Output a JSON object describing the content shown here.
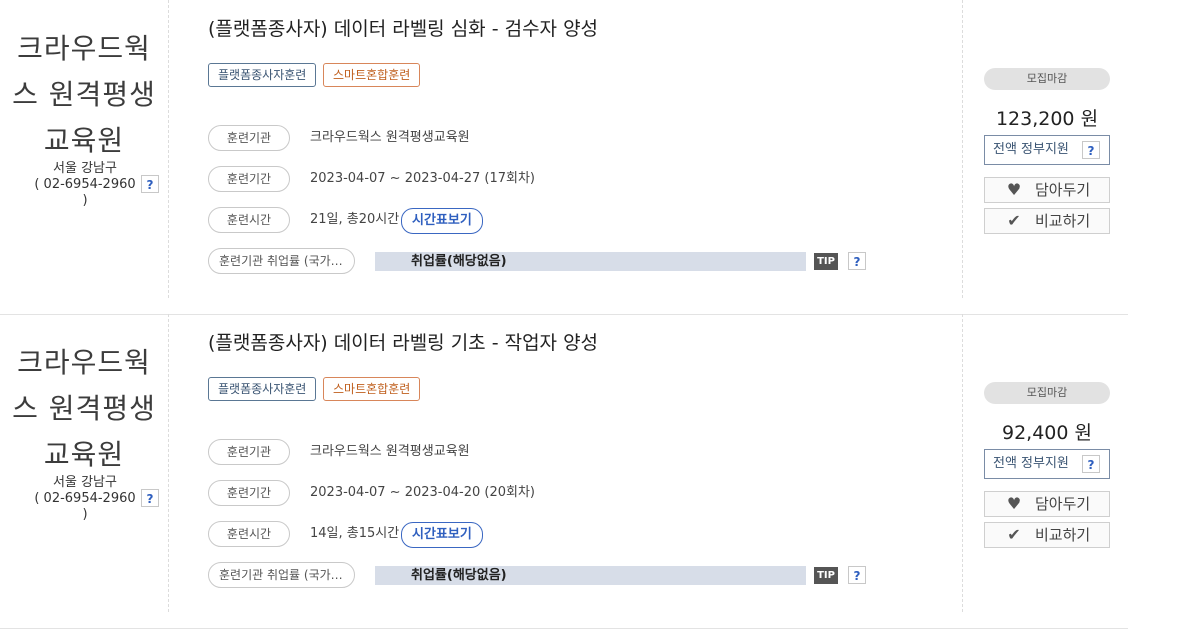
{
  "courses": [
    {
      "institution": {
        "name_line1": "크라우드웍",
        "name_line2": "스 원격평생",
        "name_line3": "교육원",
        "region": "서울 강남구",
        "phone": "( 02-6954-2960 )",
        "help": "?"
      },
      "title": "(플랫폼종사자) 데이터 라벨링 심화 - 검수자 양성",
      "tags": [
        "플랫폼종사자훈련",
        "스마트혼합훈련"
      ],
      "rows": {
        "org_label": "훈련기관",
        "org_value": "크라우드웍스 원격평생교육원",
        "period_label": "훈련기간",
        "period_value": "2023-04-07 ~ 2023-04-27 (17회차)",
        "time_label": "훈련시간",
        "time_value": "21일, 총20시간",
        "timetable_button": "시간표보기",
        "employment_label": "훈련기관 취업률 (국가…",
        "employment_value": "취업률(해당없음)",
        "tip": "TIP",
        "help": "?"
      },
      "side": {
        "status": "모집마감",
        "price": "123,200 원",
        "support": "전액 정부지원",
        "support_help": "?",
        "save_label": "담아두기",
        "compare_label": "비교하기"
      }
    },
    {
      "institution": {
        "name_line1": "크라우드웍",
        "name_line2": "스 원격평생",
        "name_line3": "교육원",
        "region": "서울 강남구",
        "phone": "( 02-6954-2960 )",
        "help": "?"
      },
      "title": "(플랫폼종사자) 데이터 라벨링 기초 - 작업자 양성",
      "tags": [
        "플랫폼종사자훈련",
        "스마트혼합훈련"
      ],
      "rows": {
        "org_label": "훈련기관",
        "org_value": "크라우드웍스 원격평생교육원",
        "period_label": "훈련기간",
        "period_value": "2023-04-07 ~ 2023-04-20 (20회차)",
        "time_label": "훈련시간",
        "time_value": "14일, 총15시간",
        "timetable_button": "시간표보기",
        "employment_label": "훈련기관 취업률 (국가…",
        "employment_value": "취업률(해당없음)",
        "tip": "TIP",
        "help": "?"
      },
      "side": {
        "status": "모집마감",
        "price": "92,400 원",
        "support": "전액 정부지원",
        "support_help": "?",
        "save_label": "담아두기",
        "compare_label": "비교하기"
      }
    }
  ],
  "icons": {
    "save": "heart-icon",
    "compare": "check-icon"
  }
}
